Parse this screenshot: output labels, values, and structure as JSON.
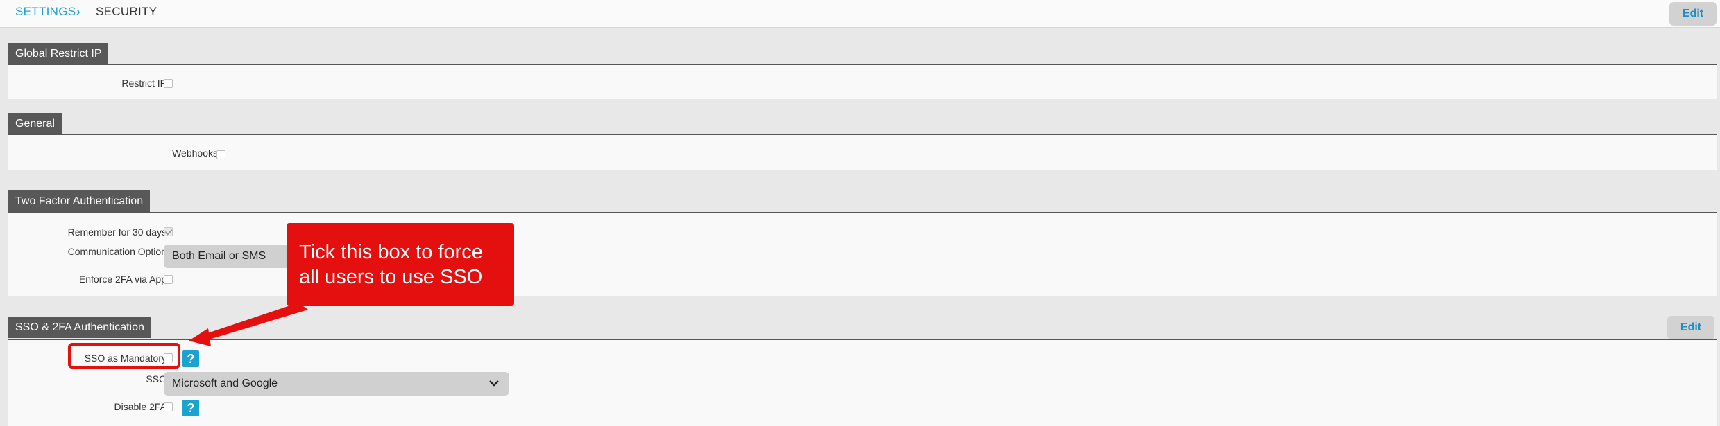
{
  "breadcrumb": {
    "parent": "SETTINGS",
    "separator": "›",
    "current": "SECURITY"
  },
  "header": {
    "edit_label": "Edit"
  },
  "sections": {
    "global_restrict_ip": {
      "title": "Global Restrict IP",
      "restrict_ip_label": "Restrict IP",
      "restrict_ip_checked": false
    },
    "general": {
      "title": "General",
      "webhooks_label": "Webhooks",
      "webhooks_checked": false
    },
    "two_factor": {
      "title": "Two Factor Authentication",
      "remember_label": "Remember for 30 days",
      "remember_checked": true,
      "comm_option_label": "Communication Option",
      "comm_option_value": "Both Email or SMS",
      "enforce_label": "Enforce 2FA via App",
      "enforce_checked": false
    },
    "sso_2fa": {
      "title": "SSO & 2FA Authentication",
      "edit_label": "Edit",
      "sso_mandatory_label": "SSO as Mandatory",
      "sso_mandatory_checked": false,
      "sso_label": "SSO",
      "sso_value": "Microsoft and Google",
      "disable_2fa_label": "Disable 2FA",
      "disable_2fa_checked": false,
      "help_glyph": "?"
    }
  },
  "annotation": {
    "callout_line1": "Tick this box to force",
    "callout_line2": "all users to use SSO",
    "color": "#e41010"
  },
  "colors": {
    "accent": "#1aa3d1",
    "section_header": "#585858"
  }
}
